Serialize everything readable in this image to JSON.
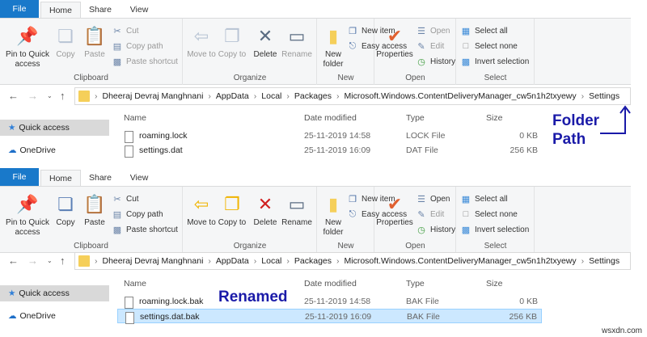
{
  "windows": [
    {
      "tabs": [
        "File",
        "Home",
        "Share",
        "View"
      ],
      "enabled": false,
      "clipboard": {
        "pin": "Pin to Quick access",
        "copy": "Copy",
        "paste": "Paste",
        "cut": "Cut",
        "copy_path": "Copy path",
        "paste_shortcut": "Paste shortcut",
        "label": "Clipboard"
      },
      "organize": {
        "move_to": "Move to",
        "copy_to": "Copy to",
        "delete": "Delete",
        "rename": "Rename",
        "label": "Organize"
      },
      "new": {
        "new_folder": "New folder",
        "new_item": "New item",
        "easy_access": "Easy access",
        "label": "New"
      },
      "open": {
        "properties": "Properties",
        "open": "Open",
        "edit": "Edit",
        "history": "History",
        "label": "Open"
      },
      "select": {
        "select_all": "Select all",
        "select_none": "Select none",
        "invert": "Invert selection",
        "label": "Select"
      },
      "path": [
        "Dheeraj Devraj Manghnani",
        "AppData",
        "Local",
        "Packages",
        "Microsoft.Windows.ContentDeliveryManager_cw5n1h2txyewy",
        "Settings"
      ],
      "nav": [
        "Quick access",
        "OneDrive"
      ],
      "columns": [
        "Name",
        "Date modified",
        "Type",
        "Size"
      ],
      "files": [
        {
          "name": "roaming.lock",
          "date": "25-11-2019 14:58",
          "type": "LOCK File",
          "size": "0 KB"
        },
        {
          "name": "settings.dat",
          "date": "25-11-2019 16:09",
          "type": "DAT File",
          "size": "256 KB"
        }
      ]
    },
    {
      "tabs": [
        "File",
        "Home",
        "Share",
        "View"
      ],
      "enabled": true,
      "clipboard": {
        "pin": "Pin to Quick access",
        "copy": "Copy",
        "paste": "Paste",
        "cut": "Cut",
        "copy_path": "Copy path",
        "paste_shortcut": "Paste shortcut",
        "label": "Clipboard"
      },
      "organize": {
        "move_to": "Move to",
        "copy_to": "Copy to",
        "delete": "Delete",
        "rename": "Rename",
        "label": "Organize"
      },
      "new": {
        "new_folder": "New folder",
        "new_item": "New item",
        "easy_access": "Easy access",
        "label": "New"
      },
      "open": {
        "properties": "Properties",
        "open": "Open",
        "edit": "Edit",
        "history": "History",
        "label": "Open"
      },
      "select": {
        "select_all": "Select all",
        "select_none": "Select none",
        "invert": "Invert selection",
        "label": "Select"
      },
      "path": [
        "Dheeraj Devraj Manghnani",
        "AppData",
        "Local",
        "Packages",
        "Microsoft.Windows.ContentDeliveryManager_cw5n1h2txyewy",
        "Settings"
      ],
      "nav": [
        "Quick access",
        "OneDrive"
      ],
      "columns": [
        "Name",
        "Date modified",
        "Type",
        "Size"
      ],
      "files": [
        {
          "name": "roaming.lock.bak",
          "date": "25-11-2019 14:58",
          "type": "BAK File",
          "size": "0 KB"
        },
        {
          "name": "settings.dat.bak",
          "date": "25-11-2019 16:09",
          "type": "BAK File",
          "size": "256 KB",
          "selected": true
        }
      ]
    }
  ],
  "annotations": {
    "folder_path": "Folder Path",
    "renamed": "Renamed"
  },
  "watermark": "wsxdn.com",
  "colors": {
    "file_tab": "#1979ca",
    "annotation": "#1a1aa8",
    "selected_row": "#cce8ff"
  }
}
